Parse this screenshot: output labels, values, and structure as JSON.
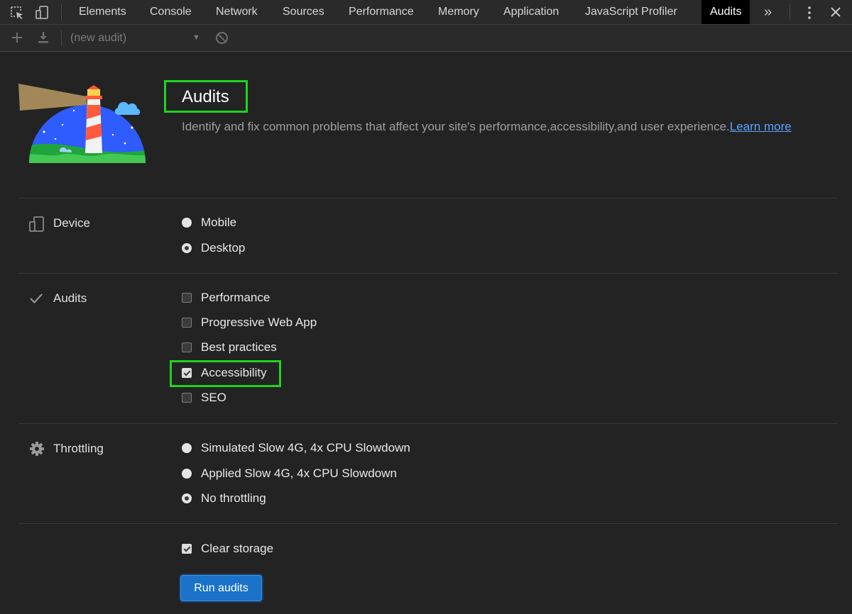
{
  "tabs": [
    {
      "label": "Elements",
      "active": false
    },
    {
      "label": "Console",
      "active": false
    },
    {
      "label": "Network",
      "active": false
    },
    {
      "label": "Sources",
      "active": false
    },
    {
      "label": "Performance",
      "active": false
    },
    {
      "label": "Memory",
      "active": false
    },
    {
      "label": "Application",
      "active": false
    },
    {
      "label": "JavaScript Profiler",
      "active": false
    },
    {
      "label": "Audits",
      "active": true
    }
  ],
  "toolbar": {
    "audit_select": "(new audit)"
  },
  "header": {
    "title": "Audits",
    "description": "Identify and fix common problems that affect your site's performance,accessibility,and user experience.",
    "learn_more": "Learn more"
  },
  "device": {
    "label": "Device",
    "options": [
      {
        "label": "Mobile",
        "checked": false
      },
      {
        "label": "Desktop",
        "checked": true
      }
    ]
  },
  "audits": {
    "label": "Audits",
    "options": [
      {
        "label": "Performance",
        "checked": false
      },
      {
        "label": "Progressive Web App",
        "checked": false
      },
      {
        "label": "Best practices",
        "checked": false
      },
      {
        "label": "Accessibility",
        "checked": true
      },
      {
        "label": "SEO",
        "checked": false
      }
    ]
  },
  "throttling": {
    "label": "Throttling",
    "options": [
      {
        "label": "Simulated Slow 4G, 4x CPU Slowdown",
        "checked": false
      },
      {
        "label": "Applied Slow 4G, 4x CPU Slowdown",
        "checked": false
      },
      {
        "label": "No throttling",
        "checked": true
      }
    ]
  },
  "storage": {
    "label": "Clear storage",
    "checked": true
  },
  "run_button": "Run audits",
  "colors": {
    "highlight": "#1fd31f",
    "button": "#1a73c8",
    "link": "#5aa3ff"
  },
  "icons": {
    "inspect": "inspect-element-icon",
    "device": "device-toolbar-icon",
    "more": "chevron-double-right-icon",
    "menu": "kebab-menu-icon",
    "close": "close-icon",
    "add": "plus-icon",
    "download": "download-icon",
    "clear": "block-icon",
    "check": "checkmark-icon",
    "gear": "gear-icon"
  }
}
